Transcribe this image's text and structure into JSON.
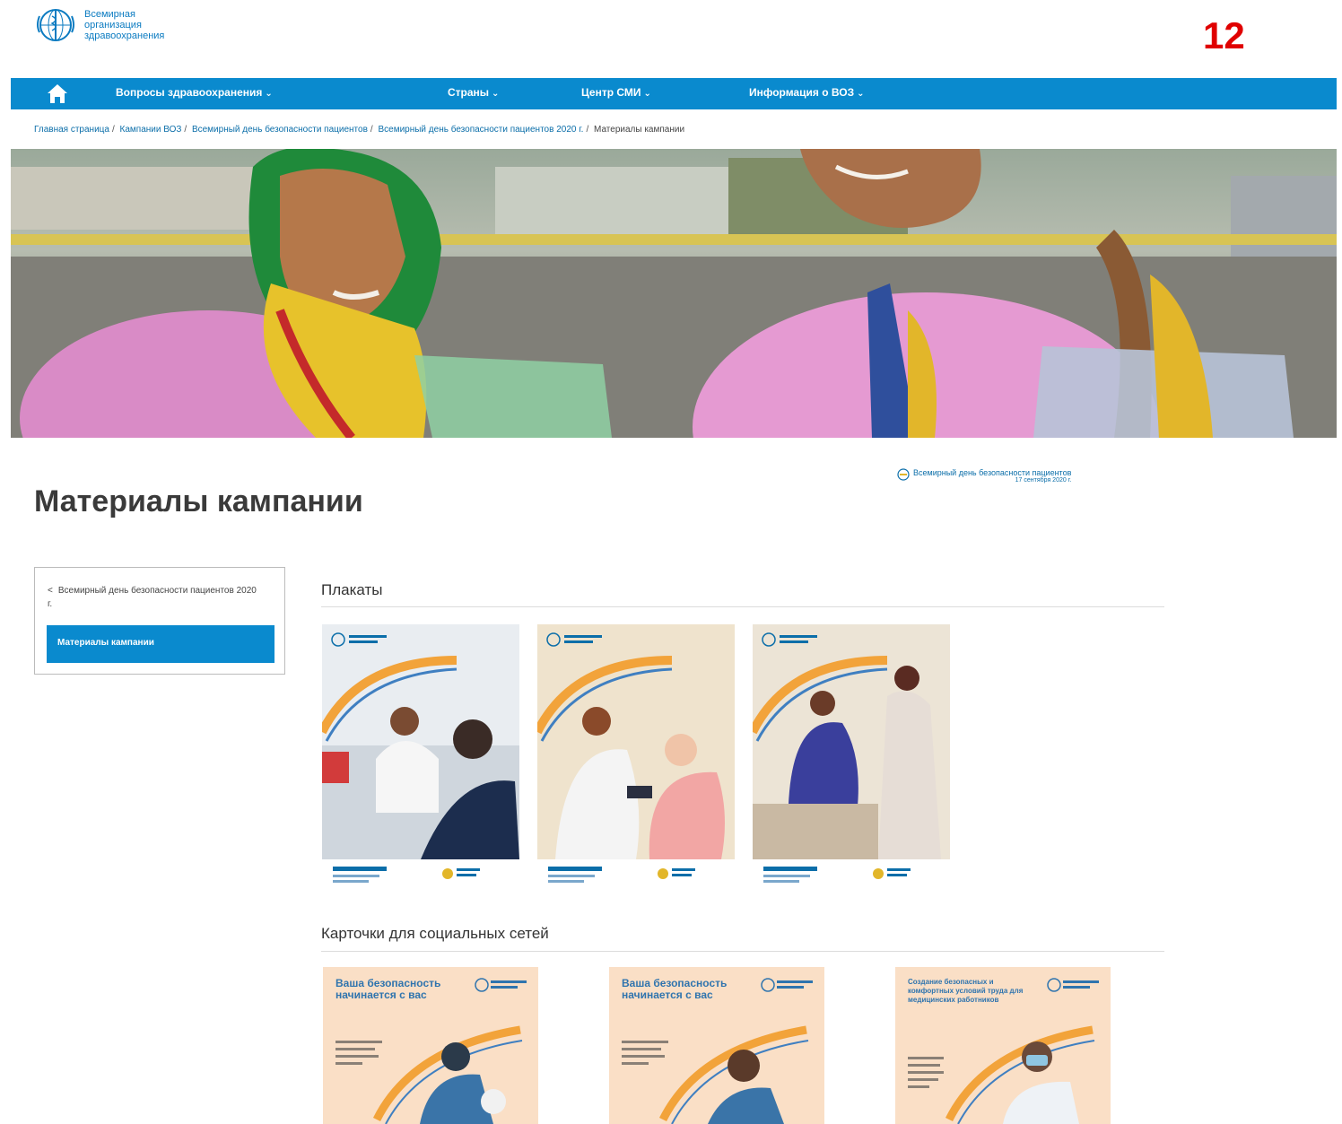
{
  "header": {
    "logo_text": "Всемирная организация здравоохранения",
    "page_number": "12"
  },
  "nav": {
    "items": [
      {
        "label": "Вопросы здравоохранения"
      },
      {
        "label": "Страны"
      },
      {
        "label": "Центр СМИ"
      },
      {
        "label": "Информация о ВОЗ"
      }
    ]
  },
  "breadcrumb": [
    "Главная страница",
    "Кампании ВОЗ",
    "Всемирный день безопасности пациентов",
    "Всемирный день безопасности пациентов 2020 г.",
    "Материалы кампании"
  ],
  "campaign_badge": {
    "title": "Всемирный день безопасности пациентов",
    "date": "17 сентября 2020 г."
  },
  "page_title": "Материалы кампании",
  "sidebar": {
    "back_label": "Всемирный день безопасности пациентов 2020 г.",
    "active_label": "Материалы кампании"
  },
  "sections": {
    "posters_title": "Плакаты",
    "cards_title": "Карточки для социальных сетей"
  },
  "cards": [
    {
      "headline": "Ваша безопасность начинается с вас"
    },
    {
      "headline": "Ваша безопасность начинается с вас"
    },
    {
      "headline": "Создание безопасных и комфортных условий труда для медицинских работников"
    }
  ],
  "colors": {
    "brand_blue": "#0a8ace",
    "page_number_red": "#e00000",
    "card_peach": "#fadfc6"
  }
}
